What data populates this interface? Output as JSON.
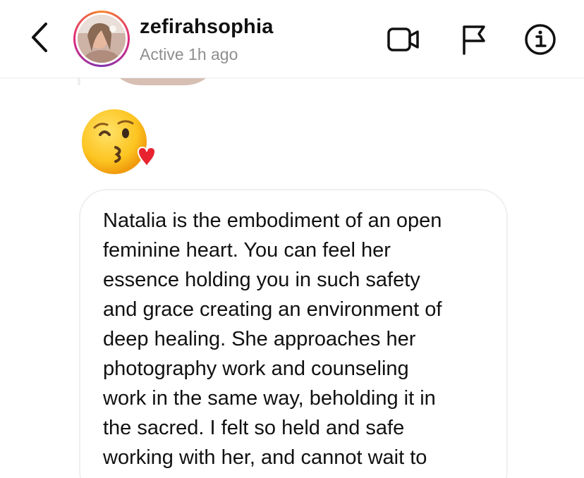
{
  "header": {
    "username": "zefirahsophia",
    "status": "Active 1h ago",
    "icons": {
      "back": "chevron-left-icon",
      "video": "video-camera-icon",
      "report": "flag-icon",
      "info": "info-icon"
    },
    "colors": {
      "story_ring": [
        "#f58529",
        "#dd2a7b",
        "#8134af"
      ]
    }
  },
  "thread": {
    "emoji": "kissing-face-with-heart-emoji",
    "message": {
      "lines": [
        "Natalia is the embodiment of an open",
        "feminine heart. You can feel her",
        "essence holding you in such safety",
        "and grace creating an environment of",
        "deep healing. She approaches her",
        "photography work and  counseling",
        "work in the same way, beholding it in",
        "the sacred. I felt so held and safe",
        "working with her, and cannot wait to"
      ]
    }
  }
}
